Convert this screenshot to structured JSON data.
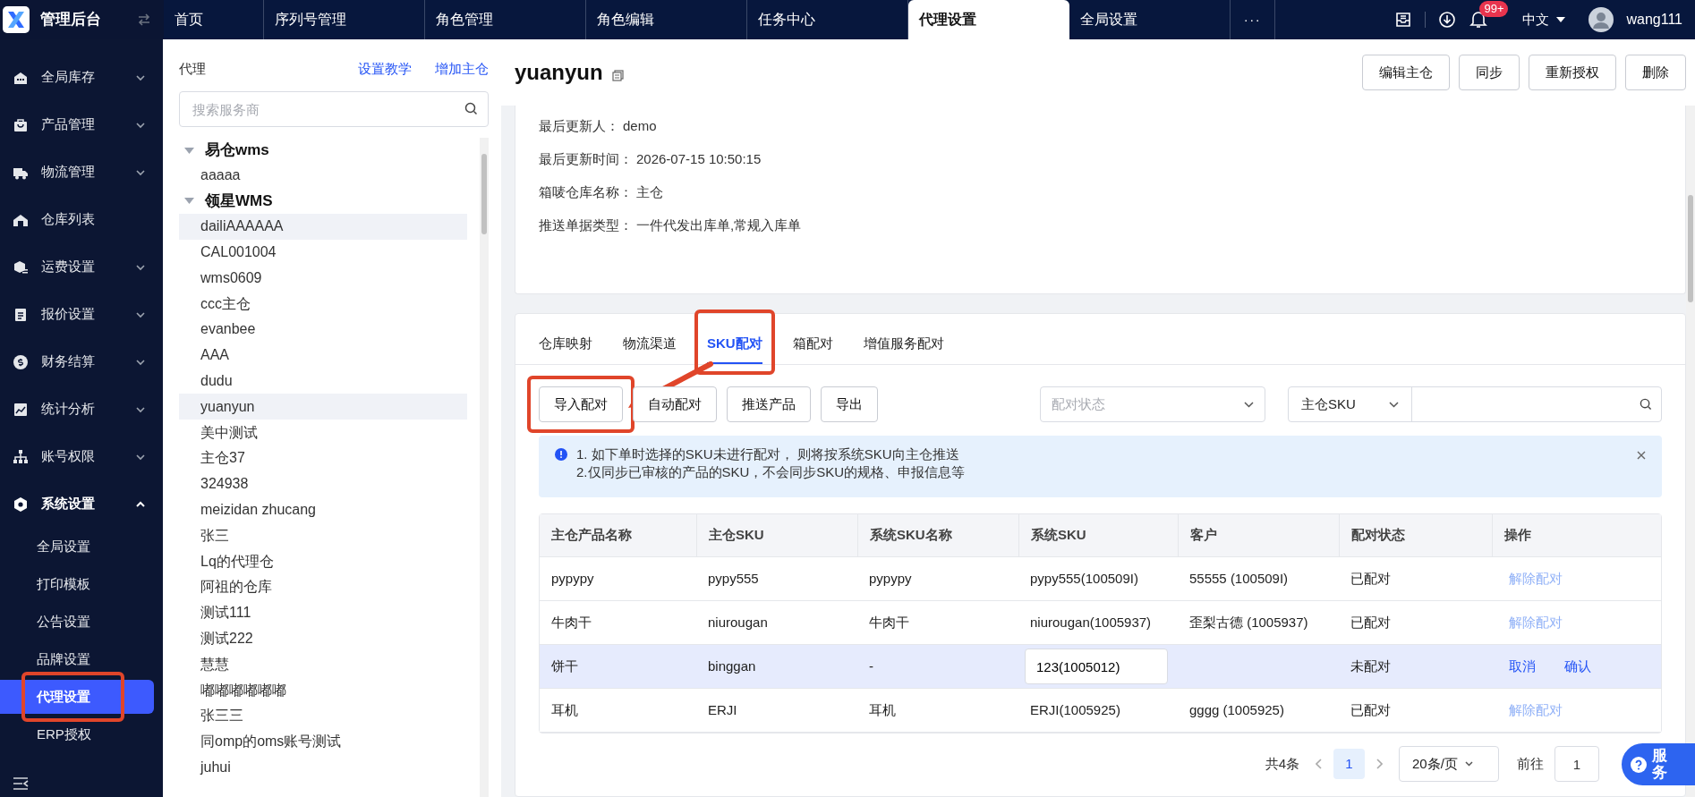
{
  "app": {
    "title": "管理后台"
  },
  "top_tabs": [
    {
      "label": "首页",
      "selected": false
    },
    {
      "label": "序列号管理",
      "selected": false
    },
    {
      "label": "角色管理",
      "selected": false
    },
    {
      "label": "角色编辑",
      "selected": false
    },
    {
      "label": "任务中心",
      "selected": false
    },
    {
      "label": "代理设置",
      "selected": true
    },
    {
      "label": "全局设置",
      "selected": false
    }
  ],
  "top_more": "···",
  "notifications_badge": "99+",
  "language": "中文",
  "user": "wang111",
  "sidebar": [
    {
      "label": "全局库存",
      "expanded": false
    },
    {
      "label": "产品管理",
      "expanded": false
    },
    {
      "label": "物流管理",
      "expanded": false
    },
    {
      "label": "仓库列表"
    },
    {
      "label": "运费设置",
      "expanded": false
    },
    {
      "label": "报价设置",
      "expanded": false
    },
    {
      "label": "财务结算",
      "expanded": false
    },
    {
      "label": "统计分析",
      "expanded": false
    },
    {
      "label": "账号权限",
      "expanded": false
    },
    {
      "label": "系统设置",
      "expanded": true,
      "children": [
        {
          "label": "全局设置",
          "selected": false,
          "highlighted": false
        },
        {
          "label": "打印模板",
          "selected": false,
          "highlighted": false
        },
        {
          "label": "公告设置",
          "selected": false,
          "highlighted": false
        },
        {
          "label": "品牌设置",
          "selected": false,
          "highlighted": false
        },
        {
          "label": "代理设置",
          "selected": true,
          "highlighted": true
        },
        {
          "label": "ERP授权",
          "selected": false,
          "highlighted": false
        }
      ]
    }
  ],
  "agent_panel": {
    "title": "代理",
    "links": [
      "设置教学",
      "增加主仓"
    ],
    "search": {
      "placeholder": "搜索服务商"
    },
    "tree": [
      {
        "label": "易仓wms",
        "expanded": true,
        "children": [
          {
            "label": "aaaaa",
            "selected": false
          }
        ]
      },
      {
        "label": "领星WMS",
        "expanded": true,
        "children": [
          {
            "label": "dailiAAAAAA",
            "selected": true
          },
          {
            "label": "CAL001004",
            "selected": false
          },
          {
            "label": "wms0609",
            "selected": false
          },
          {
            "label": "ccc主仓",
            "selected": false
          },
          {
            "label": "evanbee",
            "selected": false
          },
          {
            "label": "AAA",
            "selected": false
          },
          {
            "label": "dudu",
            "selected": false
          },
          {
            "label": "yuanyun",
            "selected": true
          },
          {
            "label": "美中测试",
            "selected": false
          },
          {
            "label": "主仓37",
            "selected": false
          },
          {
            "label": "324938",
            "selected": false
          },
          {
            "label": "meizidan zhucang",
            "selected": false
          },
          {
            "label": "张三",
            "selected": false
          },
          {
            "label": "Lq的代理仓",
            "selected": false
          },
          {
            "label": "阿祖的仓库",
            "selected": false
          },
          {
            "label": "测试111",
            "selected": false
          },
          {
            "label": "测试222",
            "selected": false
          },
          {
            "label": "慧慧",
            "selected": false
          },
          {
            "label": "嘟嘟嘟嘟嘟嘟",
            "selected": false
          },
          {
            "label": "张三三",
            "selected": false
          },
          {
            "label": "同omp的oms账号测试",
            "selected": false
          },
          {
            "label": "juhui",
            "selected": false
          }
        ]
      }
    ]
  },
  "detail": {
    "title": "yuanyun",
    "buttons": [
      "编辑主仓",
      "同步",
      "重新授权",
      "删除"
    ],
    "fields": [
      {
        "label": "最后更新人：",
        "value": "demo"
      },
      {
        "label": "最后更新时间：",
        "value": "2026-07-15 10:50:15"
      },
      {
        "label": "箱唛仓库名称：",
        "value": "主仓"
      },
      {
        "label": "推送单据类型：",
        "value": "一件代发出库单,常规入库单"
      }
    ]
  },
  "tabs": [
    {
      "label": "仓库映射",
      "selected": false,
      "highlighted": false
    },
    {
      "label": "物流渠道",
      "selected": false,
      "highlighted": false
    },
    {
      "label": "SKU配对",
      "selected": true,
      "highlighted": true
    },
    {
      "label": "箱配对",
      "selected": false,
      "highlighted": false
    },
    {
      "label": "增值服务配对",
      "selected": false,
      "highlighted": false
    }
  ],
  "toolbar": {
    "buttons": [
      {
        "label": "导入配对",
        "highlighted": true
      },
      {
        "label": "自动配对",
        "highlighted": false
      },
      {
        "label": "推送产品",
        "highlighted": false
      },
      {
        "label": "导出",
        "highlighted": false
      }
    ],
    "status_filter": {
      "placeholder": "配对状态"
    },
    "search_type": "主仓SKU"
  },
  "notice": [
    "1. 如下单时选择的SKU未进行配对， 则将按系统SKU向主仓推送",
    "2.仅同步已审核的产品的SKU，不会同步SKU的规格、申报信息等"
  ],
  "table": {
    "columns": [
      "主仓产品名称",
      "主仓SKU",
      "系统SKU名称",
      "系统SKU",
      "客户",
      "配对状态",
      "操作"
    ],
    "rows": [
      {
        "editing": false,
        "cells": [
          "pypypy",
          "pypy555",
          "pypypy",
          "pypy555(100509I)",
          "55555 (100509I)",
          "已配对"
        ],
        "actions": [
          "解除配对"
        ]
      },
      {
        "editing": false,
        "cells": [
          "牛肉干",
          "niurougan",
          "牛肉干",
          "niurougan(1005937)",
          "歪梨古德 (1005937)",
          "已配对"
        ],
        "actions": [
          "解除配对"
        ]
      },
      {
        "editing": true,
        "cells": [
          "饼干",
          "binggan",
          "-",
          "123(1005012)",
          null,
          "未配对"
        ],
        "actions": [
          "取消",
          "确认"
        ]
      },
      {
        "editing": false,
        "cells": [
          "耳机",
          "ERJI",
          "耳机",
          "ERJI(1005925)",
          "gggg (1005925)",
          "已配对"
        ],
        "actions": [
          "解除配对"
        ]
      }
    ]
  },
  "pagination": {
    "total": "共4条",
    "pages": [
      {
        "label": "1",
        "selected": true
      }
    ],
    "page_size": "20条/页",
    "goto_label": "前往",
    "goto_value": "1"
  },
  "service_button": "服务"
}
